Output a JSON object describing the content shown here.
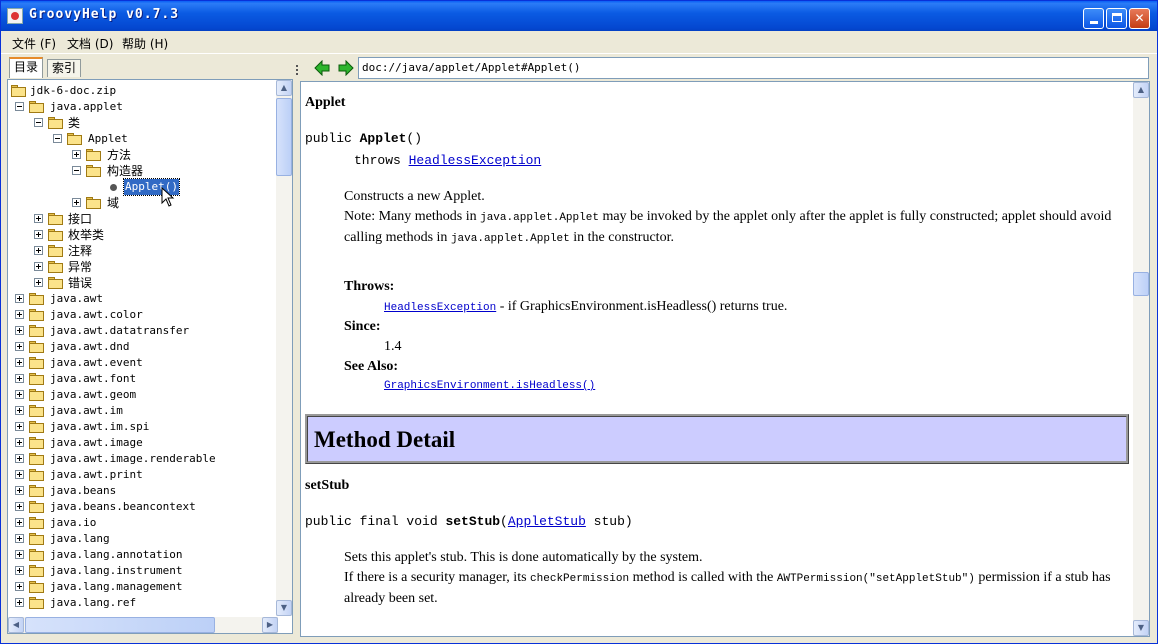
{
  "window": {
    "title": "GroovyHelp v0.7.3"
  },
  "menu": [
    {
      "label": "文件 (F)"
    },
    {
      "label": "文档 (D)"
    },
    {
      "label": "帮助 (H)"
    }
  ],
  "tabs": [
    {
      "label": "目录"
    },
    {
      "label": "索引"
    }
  ],
  "tree": {
    "root": "jdk-6-doc.zip",
    "applet_pkg": "java.applet",
    "class_folder": "类",
    "applet_class": "Applet",
    "methods_folder": "方法",
    "ctor_folder": "构造器",
    "ctor_item": "Applet()",
    "fields_folder": "域",
    "sub_folders": [
      "接口",
      "枚举类",
      "注释",
      "异常",
      "错误"
    ],
    "packages": [
      "java.awt",
      "java.awt.color",
      "java.awt.datatransfer",
      "java.awt.dnd",
      "java.awt.event",
      "java.awt.font",
      "java.awt.geom",
      "java.awt.im",
      "java.awt.im.spi",
      "java.awt.image",
      "java.awt.image.renderable",
      "java.awt.print",
      "java.beans",
      "java.beans.beancontext",
      "java.io",
      "java.lang",
      "java.lang.annotation",
      "java.lang.instrument",
      "java.lang.management",
      "java.lang.ref"
    ]
  },
  "nav": {
    "url": "doc://java/applet/Applet#Applet()"
  },
  "doc": {
    "heading": "Applet",
    "sig_prefix": "public ",
    "sig_name": "Applet",
    "sig_suffix": "()",
    "throws_prefix": "throws ",
    "throws_link": "HeadlessException",
    "desc1": "Constructs a new Applet.",
    "desc2_a": "Note: Many methods in ",
    "desc2_code1": "java.applet.Applet",
    "desc2_b": " may be invoked by the applet only after the applet is fully constructed; applet should avoid",
    "desc3_a": "calling methods in ",
    "desc3_code": "java.applet.Applet",
    "desc3_b": " in the constructor.",
    "throws_label": "Throws:",
    "throws_detail_link": "HeadlessException",
    "throws_detail_text": " - if GraphicsEnvironment.isHeadless() returns true.",
    "since_label": "Since:",
    "since_value": "1.4",
    "see_label": "See Also:",
    "see_link": "GraphicsEnvironment.isHeadless()",
    "method_detail": "Method Detail",
    "m2_heading": "setStub",
    "m2_sig_prefix": "public final void ",
    "m2_sig_name": "setStub",
    "m2_sig_open": "(",
    "m2_sig_link": "AppletStub",
    "m2_sig_rest": "  stub)",
    "m2_desc1": "Sets this applet's stub. This is done automatically by the system.",
    "m2_desc2_a": "If there is a security manager, its ",
    "m2_desc2_code": "checkPermission",
    "m2_desc2_b": " method is called with the ",
    "m2_desc2_code2": "AWTPermission(\"setAppletStub\")",
    "m2_desc2_c": " permission if a stub has",
    "m2_desc3": "already been set."
  }
}
